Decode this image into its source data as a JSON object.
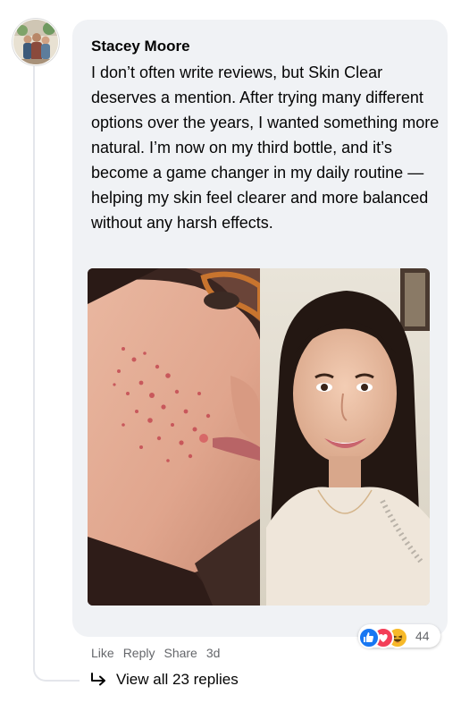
{
  "comment": {
    "author": "Stacey Moore",
    "text": "I don’t often write reviews, but Skin Clear deserves a mention. After trying many different options over the years, I wanted something more natural. I’m now on my third bottle, and it’s become a game changer in my daily routine — helping my skin feel clearer and more balanced without any harsh effects.",
    "avatar_icon": "profile-photo",
    "photo": {
      "left_panel": "before-acne-closeup",
      "right_panel": "after-clear-skin-portrait"
    }
  },
  "reactions": {
    "icons": [
      "like-icon",
      "love-icon",
      "haha-icon"
    ],
    "count": "44",
    "colors": {
      "like": "#1877f2",
      "love": "#f33e58",
      "haha": "#f7b928"
    }
  },
  "actions": {
    "like": "Like",
    "reply": "Reply",
    "share": "Share",
    "time": "3d"
  },
  "replies": {
    "label": "View all 23 replies",
    "icon": "reply-arrow-icon"
  },
  "colors": {
    "bubble": "#f0f2f5",
    "muted_text": "#65676b",
    "thread_line": "#e4e6eb"
  }
}
